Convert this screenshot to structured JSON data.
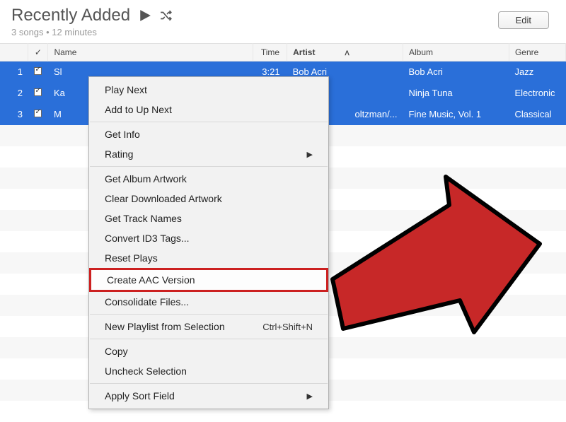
{
  "header": {
    "title": "Recently Added",
    "subtitle": "3 songs • 12 minutes",
    "edit_label": "Edit"
  },
  "columns": {
    "check": "✓",
    "name": "Name",
    "time": "Time",
    "artist": "Artist",
    "album": "Album",
    "genre": "Genre"
  },
  "rows": [
    {
      "num": "1",
      "name": "Sl",
      "time": "3:21",
      "artist": "Bob Acri",
      "album": "Bob Acri",
      "genre": "Jazz"
    },
    {
      "num": "2",
      "name": "Ka",
      "time": "",
      "artist": "",
      "album": "Ninja Tuna",
      "genre": "Electronic"
    },
    {
      "num": "3",
      "name": "M",
      "time": "",
      "artist": "oltzman/...",
      "album": "Fine Music, Vol. 1",
      "genre": "Classical"
    }
  ],
  "menu": {
    "play_next": "Play Next",
    "add_up_next": "Add to Up Next",
    "get_info": "Get Info",
    "rating": "Rating",
    "get_artwork": "Get Album Artwork",
    "clear_artwork": "Clear Downloaded Artwork",
    "get_tracks": "Get Track Names",
    "convert_id3": "Convert ID3 Tags...",
    "reset_plays": "Reset Plays",
    "create_aac": "Create AAC Version",
    "consolidate": "Consolidate Files...",
    "new_playlist": "New Playlist from Selection",
    "new_playlist_shortcut": "Ctrl+Shift+N",
    "copy": "Copy",
    "uncheck": "Uncheck Selection",
    "apply_sort": "Apply Sort Field"
  }
}
